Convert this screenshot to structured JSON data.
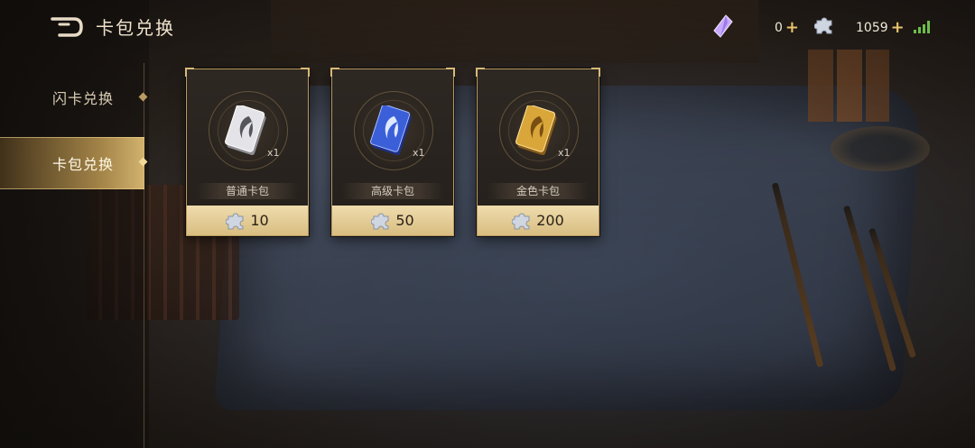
{
  "header": {
    "title": "卡包兑换",
    "currency_crystal": "0",
    "currency_puzzle": "1059",
    "plus_symbol": "+"
  },
  "sidebar": {
    "items": [
      {
        "label": "闪卡兑换",
        "selected": false
      },
      {
        "label": "卡包兑换",
        "selected": true
      }
    ]
  },
  "packs": [
    {
      "name": "普通卡包",
      "qty": "x1",
      "price": "10",
      "color": "#d9d9dc"
    },
    {
      "name": "高级卡包",
      "qty": "x1",
      "price": "50",
      "color": "#3a5fd8"
    },
    {
      "name": "金色卡包",
      "qty": "x1",
      "price": "200",
      "color": "#d9a63a"
    }
  ],
  "colors": {
    "accent_gold": "#d8bd80",
    "selected_tab": "#d2aa5a",
    "signal_green": "#6cc04a"
  },
  "icons": [
    "back-arrow-icon",
    "crystal-icon",
    "puzzle-piece-icon",
    "signal-icon",
    "card-pack-icon"
  ]
}
